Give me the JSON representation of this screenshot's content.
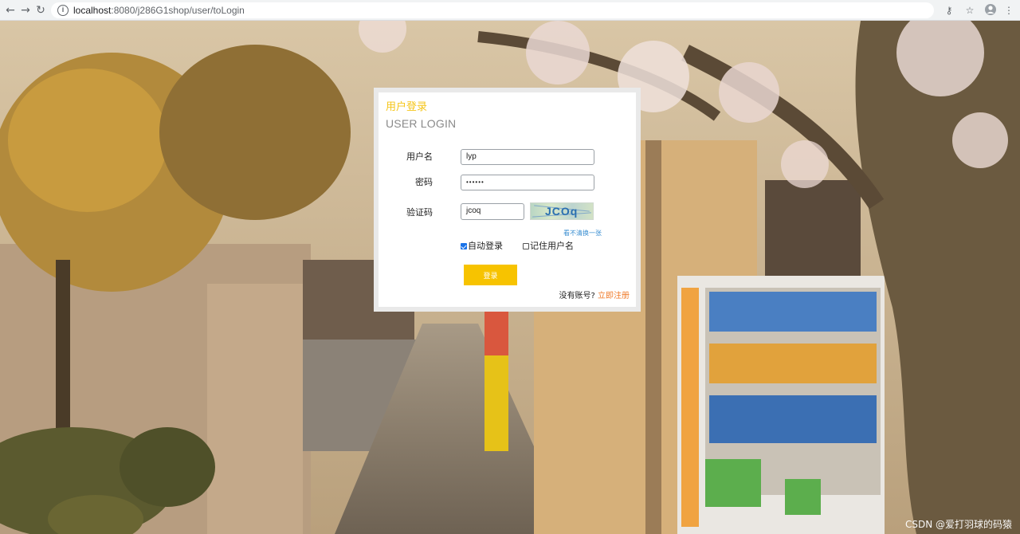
{
  "browser": {
    "url_host": "localhost",
    "url_path": ":8080/j286G1shop/user/toLogin",
    "back_icon": "arrow-left-icon",
    "forward_icon": "arrow-right-icon",
    "reload_icon": "reload-icon",
    "info_icon": "info-icon",
    "key_icon": "key-icon",
    "star_icon": "star-icon",
    "profile_icon": "profile-icon",
    "menu_icon": "kebab-menu-icon"
  },
  "login": {
    "title_cn": "用户登录",
    "title_en": "USER LOGIN",
    "username_label": "用户名",
    "username_value": "lyp",
    "password_label": "密码",
    "password_value": "••••••",
    "captcha_label": "验证码",
    "captcha_value": "jcoq",
    "captcha_image_text": "JCOq",
    "refresh_captcha": "看不清换一张",
    "auto_login_label": "自动登录",
    "auto_login_checked": true,
    "remember_username_label": "记住用户名",
    "remember_username_checked": false,
    "submit_label": "登录",
    "no_account_text": "没有账号?",
    "register_link": "立即注册"
  },
  "watermark": "CSDN @爱打羽球的码猿",
  "colors": {
    "accent_yellow": "#f7c300",
    "title_yellow": "#f5c518",
    "link_blue": "#3b8fd1",
    "register_orange": "#f07b2a"
  }
}
